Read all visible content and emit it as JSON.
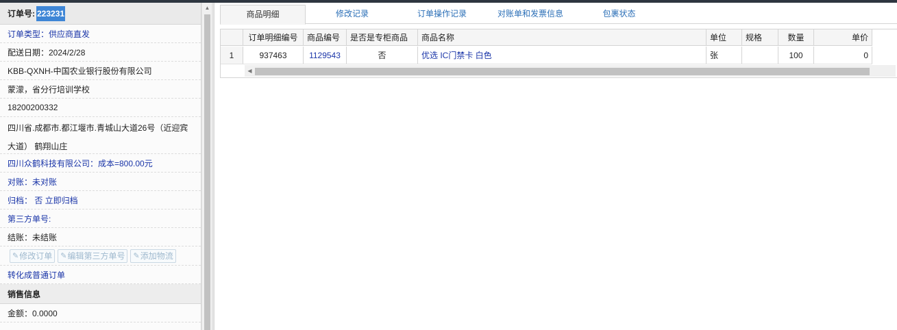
{
  "order": {
    "number_label": "订单号:",
    "number_value": "223231",
    "type": "订单类型：供应商直发",
    "delivery_date": "配送日期：2024/2/28",
    "customer": "KBB-QXNH-中国农业银行股份有限公司",
    "contact": "蒙濛，省分行培训学校",
    "phone": "18200200332",
    "address": "四川省.成都市.都江堰市.青城山大道26号（近迎宾大道） 鹤翔山庄",
    "supplier": "四川众鹤科技有限公司：成本=800.00元",
    "reconcile": "对账：未对账",
    "archive": "归档： 否 立即归档",
    "third_party_no": "第三方单号:",
    "settle": "结账：未结账",
    "buttons": {
      "edit_order": "修改订单",
      "edit_third_party": "编辑第三方单号",
      "add_logistics": "添加物流"
    },
    "convert": "转化成普通订单"
  },
  "sales": {
    "title": "销售信息",
    "amount": "金额：0.0000"
  },
  "tabs": [
    {
      "label": "商品明细",
      "active": true
    },
    {
      "label": "修改记录",
      "active": false
    },
    {
      "label": "订单操作记录",
      "active": false
    },
    {
      "label": "对账单和发票信息",
      "active": false
    },
    {
      "label": "包裹状态",
      "active": false
    }
  ],
  "grid": {
    "headers": [
      "",
      "订单明细编号",
      "商品编号",
      "是否是专柜商品",
      "商品名称",
      "单位",
      "规格",
      "数量",
      "单价"
    ],
    "rows": [
      [
        "1",
        "937463",
        "1129543",
        "否",
        "优选 IC门禁卡 白色",
        "张",
        "",
        "100",
        "0"
      ]
    ]
  },
  "icons": {
    "edit": "edit-icon",
    "scroll_up": "chevron-up-icon",
    "scroll_left": "chevron-left-icon"
  }
}
